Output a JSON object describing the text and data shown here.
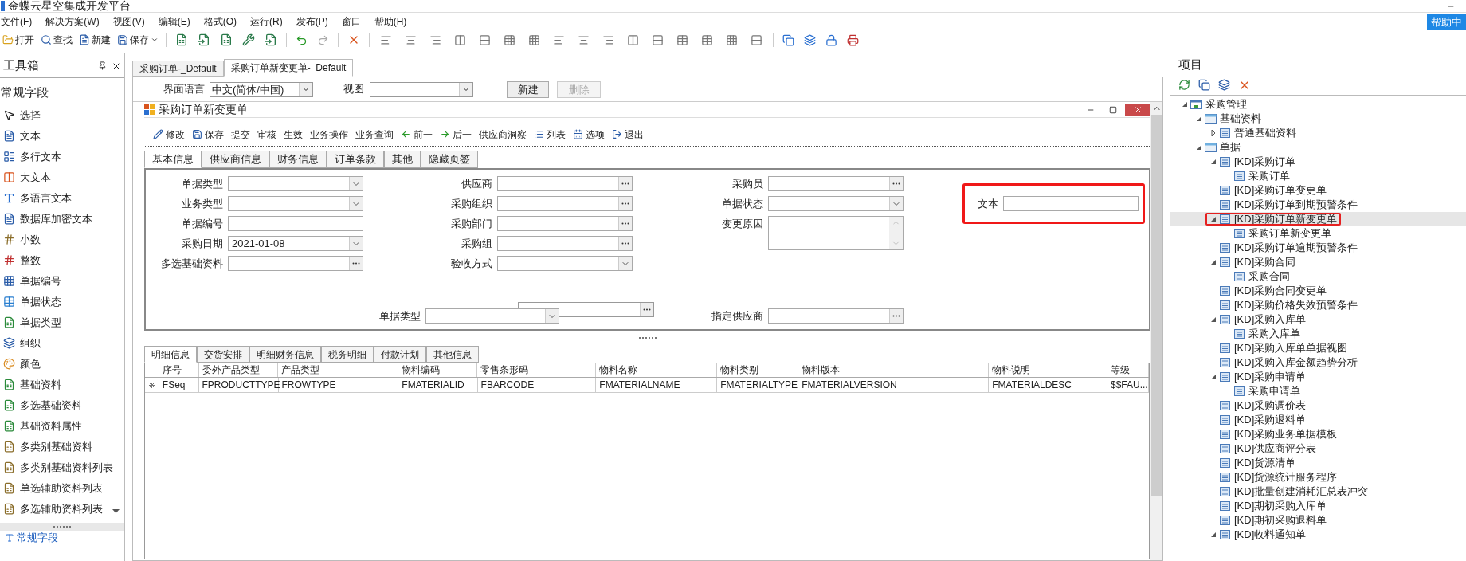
{
  "window": {
    "title": "金蝶云星空集成开发平台"
  },
  "menu": [
    "文件(F)",
    "解决方案(W)",
    "视图(V)",
    "编辑(E)",
    "格式(O)",
    "运行(R)",
    "发布(P)",
    "窗口",
    "帮助(H)"
  ],
  "help_button": "帮助中",
  "toolbar": [
    {
      "label": "打开"
    },
    {
      "label": "查找"
    },
    {
      "label": "新建"
    },
    {
      "label": "保存"
    }
  ],
  "toolbox": {
    "title": "工具箱",
    "category": "常规字段",
    "items": [
      "选择",
      "文本",
      "多行文本",
      "大文本",
      "多语言文本",
      "数据库加密文本",
      "小数",
      "整数",
      "单据编号",
      "单据状态",
      "单据类型",
      "组织",
      "颜色",
      "基础资料",
      "多选基础资料",
      "基础资料属性",
      "多类别基础资料",
      "多类别基础资料列表",
      "单选辅助资料列表",
      "多选辅助资料列表"
    ],
    "footer_category": "常规字段"
  },
  "doc_tabs": [
    {
      "label": "采购订单-_Default",
      "selected": false
    },
    {
      "label": "采购订单新变更单-_Default",
      "selected": true
    }
  ],
  "view_bar": {
    "language_label": "界面语言",
    "language_value": "中文(简体/中国)",
    "view_label": "视图",
    "new_button": "新建",
    "delete_button": "删除",
    "delete_disabled": true
  },
  "form_window": {
    "title": "采购订单新变更单",
    "toolbar": [
      "修改",
      "保存",
      "提交",
      "审核",
      "生效",
      "业务操作",
      "业务查询",
      "前一",
      "后一",
      "供应商洞察",
      "列表",
      "选项",
      "退出"
    ],
    "tabs": [
      {
        "label": "基本信息",
        "selected": true
      },
      {
        "label": "供应商信息",
        "selected": false
      },
      {
        "label": "财务信息",
        "selected": false
      },
      {
        "label": "订单条款",
        "selected": false
      },
      {
        "label": "其他",
        "selected": false
      },
      {
        "label": "隐藏页签",
        "selected": false
      }
    ],
    "left_fields": [
      {
        "label": "单据类型",
        "kind": "combo"
      },
      {
        "label": "业务类型",
        "kind": "combo"
      },
      {
        "label": "单据编号",
        "kind": "text"
      },
      {
        "label": "采购日期",
        "kind": "combo",
        "value": "2021-01-08"
      },
      {
        "label": "多选基础资料",
        "kind": "lookup"
      }
    ],
    "middle_fields": [
      {
        "label": "供应商",
        "kind": "lookup"
      },
      {
        "label": "采购组织",
        "kind": "lookup"
      },
      {
        "label": "采购部门",
        "kind": "lookup"
      },
      {
        "label": "采购组",
        "kind": "lookup"
      },
      {
        "label": "验收方式",
        "kind": "combo"
      }
    ],
    "right_fields": [
      {
        "label": "采购员",
        "kind": "lookup"
      },
      {
        "label": "单据状态",
        "kind": "combo"
      },
      {
        "label": "变更原因",
        "kind": "textarea"
      }
    ],
    "extra_field": {
      "label": "文本",
      "kind": "text",
      "annotated": true
    },
    "bottom_fields": [
      {
        "label": "单据类型",
        "kind": "combo"
      },
      {
        "label": "指定供应商",
        "kind": "lookup"
      }
    ],
    "detail_tabs": [
      {
        "label": "明细信息",
        "selected": true
      },
      {
        "label": "交货安排",
        "selected": false
      },
      {
        "label": "明细财务信息",
        "selected": false
      },
      {
        "label": "税务明细",
        "selected": false
      },
      {
        "label": "付款计划",
        "selected": false
      },
      {
        "label": "其他信息",
        "selected": false
      }
    ],
    "grid": {
      "columns": [
        "序号",
        "委外产品类型",
        "产品类型",
        "物料编码",
        "零售条形码",
        "物料名称",
        "物料类别",
        "物料版本",
        "物料说明",
        "等级"
      ],
      "rows": [
        [
          "FSeq",
          "FPRODUCTTYPE",
          "FROWTYPE",
          "FMATERIALID",
          "FBARCODE",
          "FMATERIALNAME",
          "FMATERIALTYPE",
          "FMATERIALVERSION",
          "FMATERIALDESC",
          "$$FAU..."
        ]
      ]
    }
  },
  "project": {
    "title": "项目",
    "tree": [
      {
        "label": "采购管理",
        "expanded": true,
        "children": [
          {
            "label": "基础资料",
            "expanded": true,
            "children": [
              {
                "label": "普通基础资料",
                "expanded": false
              }
            ]
          },
          {
            "label": "单据",
            "expanded": true,
            "children": [
              {
                "label": "[KD]采购订单",
                "expanded": true,
                "children": [
                  {
                    "label": "采购订单"
                  }
                ]
              },
              {
                "label": "[KD]采购订单变更单"
              },
              {
                "label": "[KD]采购订单到期预警条件"
              },
              {
                "label": "[KD]采购订单新变更单",
                "expanded": true,
                "selected": true,
                "annotated": true,
                "children": [
                  {
                    "label": "采购订单新变更单"
                  }
                ]
              },
              {
                "label": "[KD]采购订单逾期预警条件"
              },
              {
                "label": "[KD]采购合同",
                "expanded": true,
                "children": [
                  {
                    "label": "采购合同"
                  }
                ]
              },
              {
                "label": "[KD]采购合同变更单"
              },
              {
                "label": "[KD]采购价格失效预警条件"
              },
              {
                "label": "[KD]采购入库单",
                "expanded": true,
                "children": [
                  {
                    "label": "采购入库单"
                  }
                ]
              },
              {
                "label": "[KD]采购入库单单据视图"
              },
              {
                "label": "[KD]采购入库金额趋势分析"
              },
              {
                "label": "[KD]采购申请单",
                "expanded": true,
                "children": [
                  {
                    "label": "采购申请单"
                  }
                ]
              },
              {
                "label": "[KD]采购调价表"
              },
              {
                "label": "[KD]采购退料单"
              },
              {
                "label": "[KD]采购业务单据模板"
              },
              {
                "label": "[KD]供应商评分表"
              },
              {
                "label": "[KD]货源清单"
              },
              {
                "label": "[KD]货源统计服务程序"
              },
              {
                "label": "[KD]批量创建消耗汇总表冲突"
              },
              {
                "label": "[KD]期初采购入库单"
              },
              {
                "label": "[KD]期初采购退料单"
              },
              {
                "label": "[KD]收料通知单",
                "expanded": true
              }
            ]
          }
        ]
      }
    ]
  }
}
